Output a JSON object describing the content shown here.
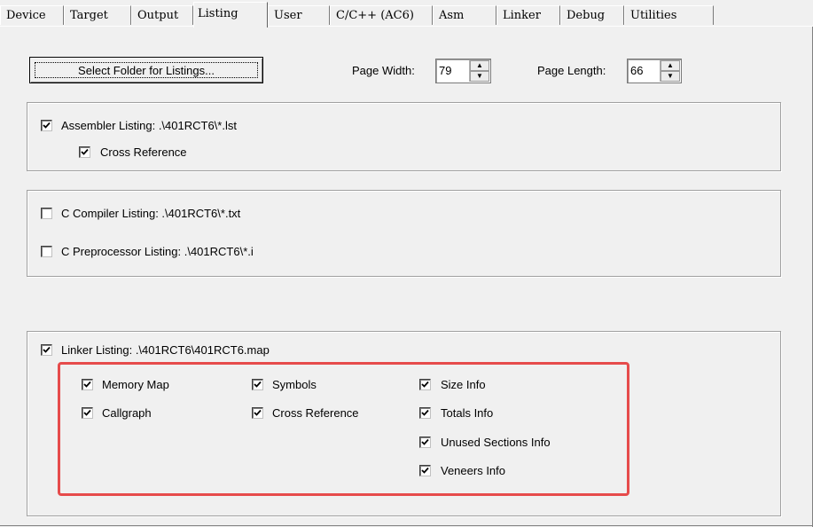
{
  "tabs": [
    "Device",
    "Target",
    "Output",
    "Listing",
    "User",
    "C/C++ (AC6)",
    "Asm",
    "Linker",
    "Debug",
    "Utilities"
  ],
  "active_tab": "Listing",
  "select_folder_button": "Select Folder for Listings...",
  "page_width": {
    "label": "Page Width:",
    "value": "79"
  },
  "page_length": {
    "label": "Page Length:",
    "value": "66"
  },
  "assembler": {
    "listing": {
      "label": "Assembler Listing:  .\\401RCT6\\*.lst",
      "checked": true
    },
    "cross_reference": {
      "label": "Cross Reference",
      "checked": true
    }
  },
  "compiler": {
    "c_compiler_listing": {
      "label": "C Compiler Listing:  .\\401RCT6\\*.txt",
      "checked": false
    },
    "c_preprocessor_listing": {
      "label": "C Preprocessor Listing:  .\\401RCT6\\*.i",
      "checked": false
    }
  },
  "linker": {
    "listing": {
      "label": "Linker Listing:  .\\401RCT6\\401RCT6.map",
      "checked": true
    },
    "options": {
      "memory_map": {
        "label": "Memory Map",
        "checked": true
      },
      "callgraph": {
        "label": "Callgraph",
        "checked": true
      },
      "symbols": {
        "label": "Symbols",
        "checked": true
      },
      "cross_reference": {
        "label": "Cross Reference",
        "checked": true
      },
      "size_info": {
        "label": "Size Info",
        "checked": true
      },
      "totals_info": {
        "label": "Totals Info",
        "checked": true
      },
      "unused_sections_info": {
        "label": "Unused Sections Info",
        "checked": true
      },
      "veneers_info": {
        "label": "Veneers Info",
        "checked": true
      }
    }
  },
  "colors": {
    "highlight": "#e64b4b",
    "background": "#f0f0f0"
  }
}
